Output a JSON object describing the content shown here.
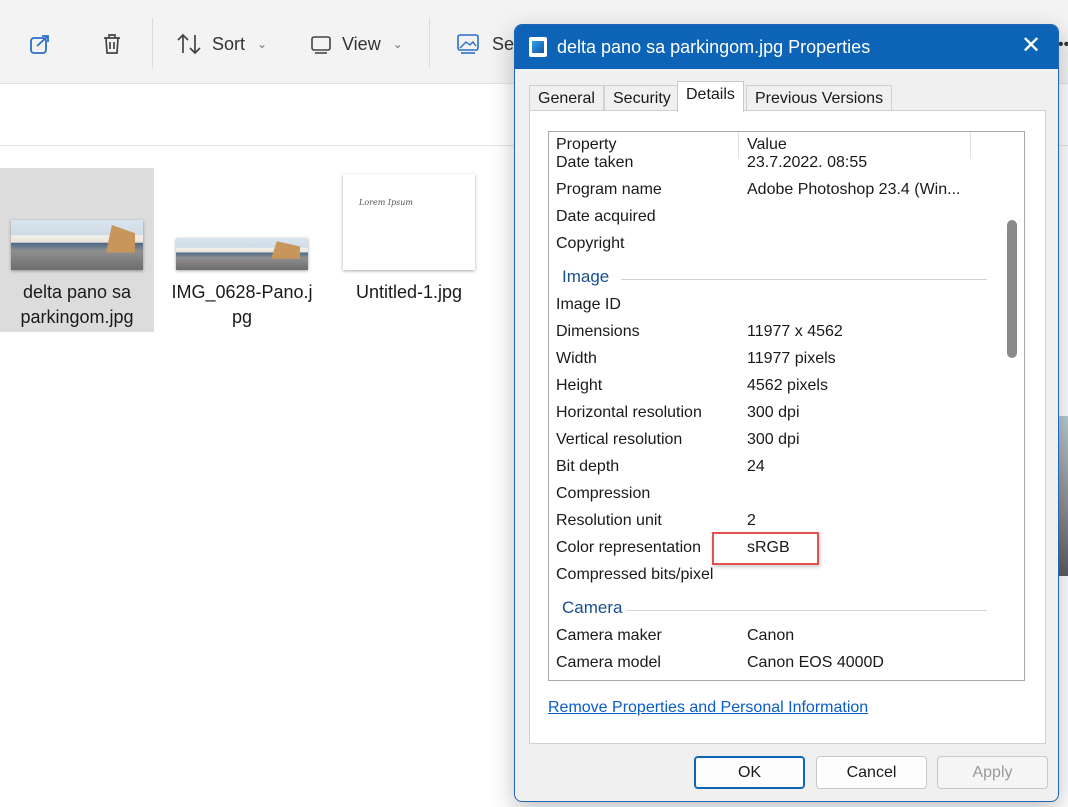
{
  "toolbar": {
    "share_icon": "share-icon",
    "delete_icon": "trash-icon",
    "sort_label": "Sort",
    "view_label": "View",
    "set_label": "Se"
  },
  "files": [
    {
      "name_line1": "delta pano sa",
      "name_line2": "parkingom.jpg"
    },
    {
      "name_line1": "IMG_0628-Pano.j",
      "name_line2": "pg"
    },
    {
      "name_line1": "Untitled-1.jpg",
      "name_line2": ""
    }
  ],
  "thumbnail_text": "Lorem Ipsum",
  "dialog": {
    "title": "delta pano sa parkingom.jpg Properties",
    "close_glyph": "✕",
    "tabs": [
      "General",
      "Security",
      "Details",
      "Previous Versions"
    ],
    "active_tab": "Details",
    "columns": {
      "property": "Property",
      "value": "Value"
    },
    "rows": [
      {
        "property": "Date taken",
        "value": "23.7.2022. 08:55"
      },
      {
        "property": "Program name",
        "value": "Adobe Photoshop 23.4 (Win..."
      },
      {
        "property": "Date acquired",
        "value": ""
      },
      {
        "property": "Copyright",
        "value": ""
      }
    ],
    "image_section": "Image",
    "image_rows": [
      {
        "property": "Image ID",
        "value": ""
      },
      {
        "property": "Dimensions",
        "value": "11977 x 4562"
      },
      {
        "property": "Width",
        "value": "11977 pixels"
      },
      {
        "property": "Height",
        "value": "4562 pixels"
      },
      {
        "property": "Horizontal resolution",
        "value": "300 dpi"
      },
      {
        "property": "Vertical resolution",
        "value": "300 dpi"
      },
      {
        "property": "Bit depth",
        "value": "24"
      },
      {
        "property": "Compression",
        "value": ""
      },
      {
        "property": "Resolution unit",
        "value": "2"
      },
      {
        "property": "Color representation",
        "value": "sRGB"
      },
      {
        "property": "Compressed bits/pixel",
        "value": ""
      }
    ],
    "camera_section": "Camera",
    "camera_rows": [
      {
        "property": "Camera maker",
        "value": "Canon"
      },
      {
        "property": "Camera model",
        "value": "Canon EOS 4000D"
      }
    ],
    "remove_link": "Remove Properties and Personal Information",
    "buttons": {
      "ok": "OK",
      "cancel": "Cancel",
      "apply": "Apply"
    }
  },
  "colors": {
    "title_bar": "#0d63b5",
    "highlight": "#e25050",
    "link": "#0a5cc7",
    "section_title": "#1a4f8f"
  }
}
